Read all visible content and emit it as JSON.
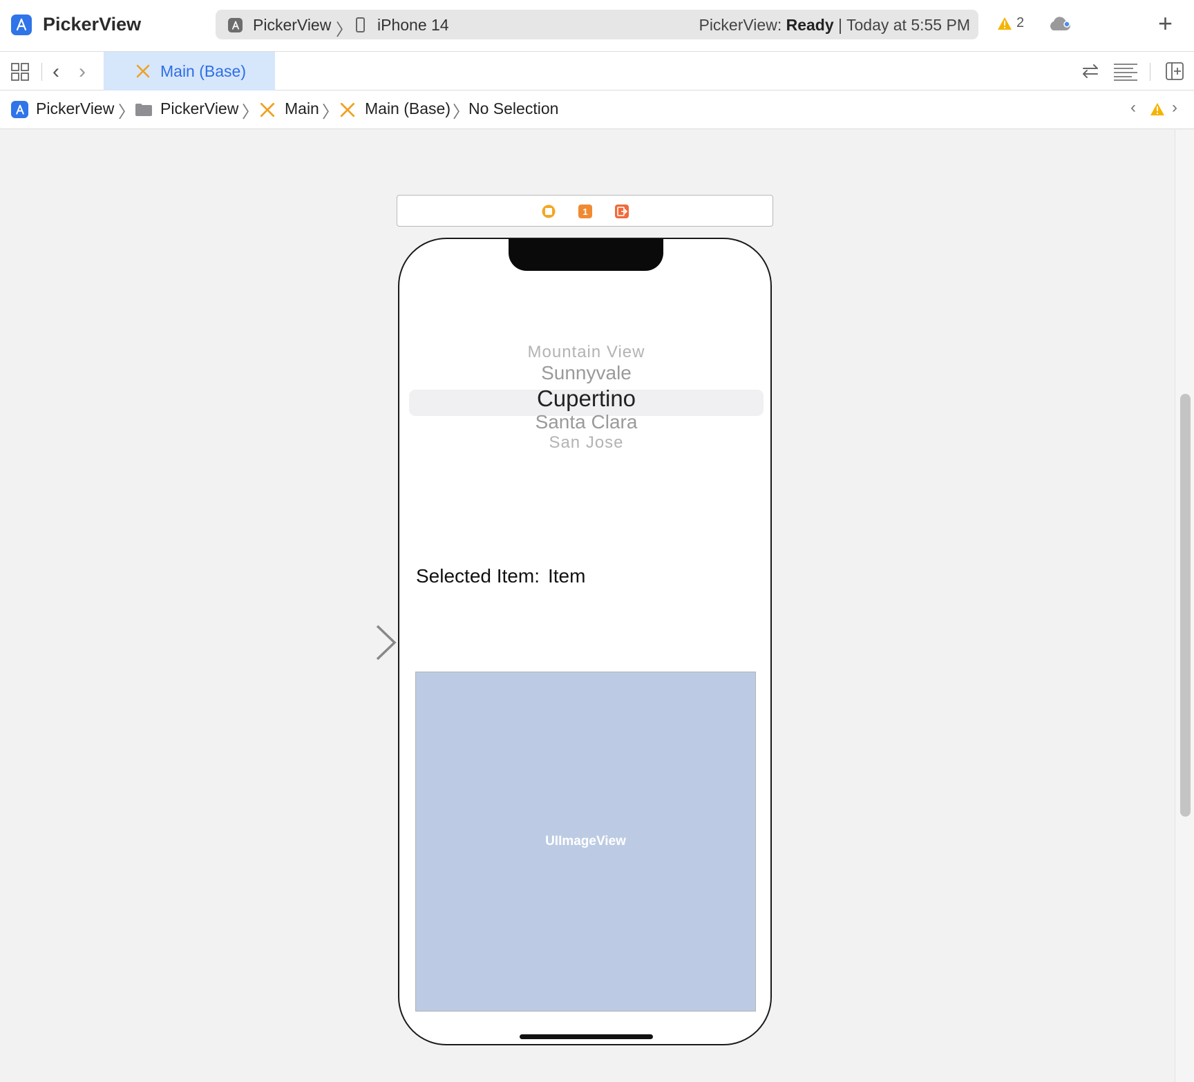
{
  "titlebar": {
    "app_title": "PickerView",
    "scheme_name": "PickerView",
    "device_name": "iPhone 14",
    "status_prefix": "PickerView: ",
    "status_state": "Ready",
    "status_time": " | Today at 5:55 PM",
    "warning_count": "2"
  },
  "tabbar": {
    "active_tab": "Main (Base)"
  },
  "breadcrumb": {
    "items": [
      "PickerView",
      "PickerView",
      "Main",
      "Main (Base)",
      "No Selection"
    ]
  },
  "canvas": {
    "picker_items": [
      "Mountain View",
      "Sunnyvale",
      "Cupertino",
      "Santa Clara",
      "San Jose"
    ],
    "selected_label": "Selected Item:",
    "selected_value": "Item",
    "image_view_label": "UIImageView"
  },
  "colors": {
    "accent": "#2e6ee6",
    "warning": "#f5b400",
    "scene_dock_orange": "#f08a32",
    "image_view_fill": "#bccbe3"
  },
  "icons": [
    "app-icon",
    "device-icon",
    "warning-icon",
    "cloud-icon",
    "plus-icon",
    "grid-icon",
    "chevron-left-icon",
    "chevron-right-icon",
    "interface-builder-icon",
    "swap-icon",
    "lines-icon",
    "add-editor-icon",
    "folder-icon",
    "view-controller-icon",
    "first-responder-icon",
    "exit-icon",
    "entry-arrow-icon"
  ]
}
